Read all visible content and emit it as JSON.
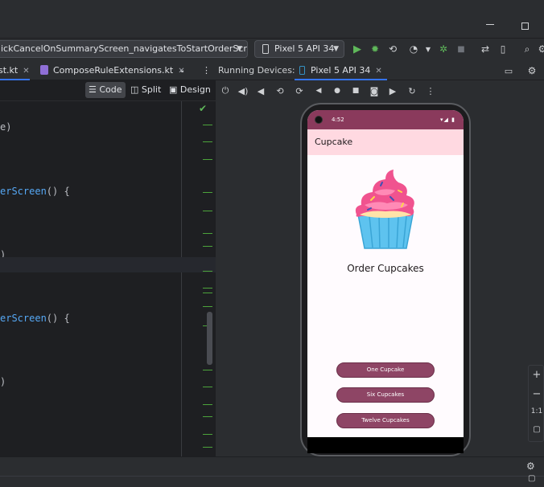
{
  "toolbar": {
    "run_config": "ickCancelOnSummaryScreen_navigatesToStartOrderScreen()",
    "device": "Pixel 5 API 34"
  },
  "tabs": [
    {
      "label": "st.kt",
      "active": true
    },
    {
      "label": "ComposeRuleExtensions.kt",
      "active": false
    }
  ],
  "editor_modes": [
    "Code",
    "Split",
    "Design"
  ],
  "running_devices": {
    "label": "Running Devices:",
    "tab": "Pixel 5 API 34"
  },
  "code": {
    "l1": "e)",
    "l2_fn": "erScreen",
    "l2_rest": "() {",
    "l3": ")",
    "l4_fn": "erScreen",
    "l4_rest": "() {",
    "l5": ")"
  },
  "phone": {
    "status_time": "4:52",
    "status_icons": "▾◢ ▮",
    "app_title": "Cupcake",
    "heading": "Order Cupcakes",
    "buttons": [
      "One Cupcake",
      "Six Cupcakes",
      "Twelve Cupcakes"
    ],
    "primary_color": "#8e4565",
    "appbar_color": "#ffd9e1"
  },
  "zoom": {
    "plus": "+",
    "minus": "−",
    "ratio": "1:1"
  }
}
